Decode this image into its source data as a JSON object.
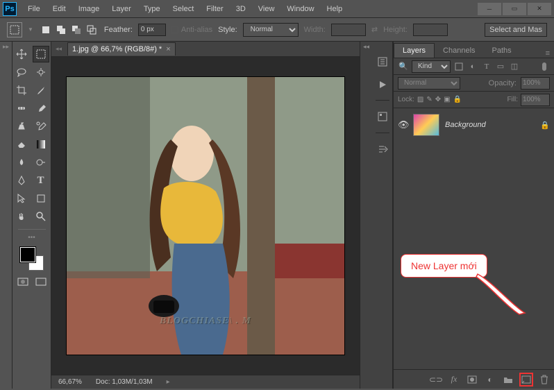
{
  "app": {
    "logo": "Ps"
  },
  "menu": [
    "File",
    "Edit",
    "Image",
    "Layer",
    "Type",
    "Select",
    "Filter",
    "3D",
    "View",
    "Window",
    "Help"
  ],
  "options": {
    "feather_label": "Feather:",
    "feather_value": "0 px",
    "antialias": "Anti-alias",
    "style_label": "Style:",
    "style_value": "Normal",
    "width_label": "Width:",
    "height_label": "Height:",
    "select_mask": "Select and Mas"
  },
  "doc": {
    "tab_title": "1.jpg @ 66,7% (RGB/8#) *",
    "zoom": "66,67%",
    "doc_info": "Doc: 1,03M/1,03M"
  },
  "panels": {
    "tabs": [
      "Layers",
      "Channels",
      "Paths"
    ],
    "filter": {
      "kind": "Kind"
    },
    "blend": {
      "mode": "Normal",
      "opacity_label": "Opacity:",
      "opacity": "100%"
    },
    "lock": {
      "label": "Lock:",
      "fill_label": "Fill:",
      "fill": "100%"
    },
    "layers": [
      {
        "name": "Background",
        "locked": true
      }
    ]
  },
  "callout": {
    "text": "New Layer mới"
  },
  "watermark": "BLOGCHIASE\\  . M"
}
